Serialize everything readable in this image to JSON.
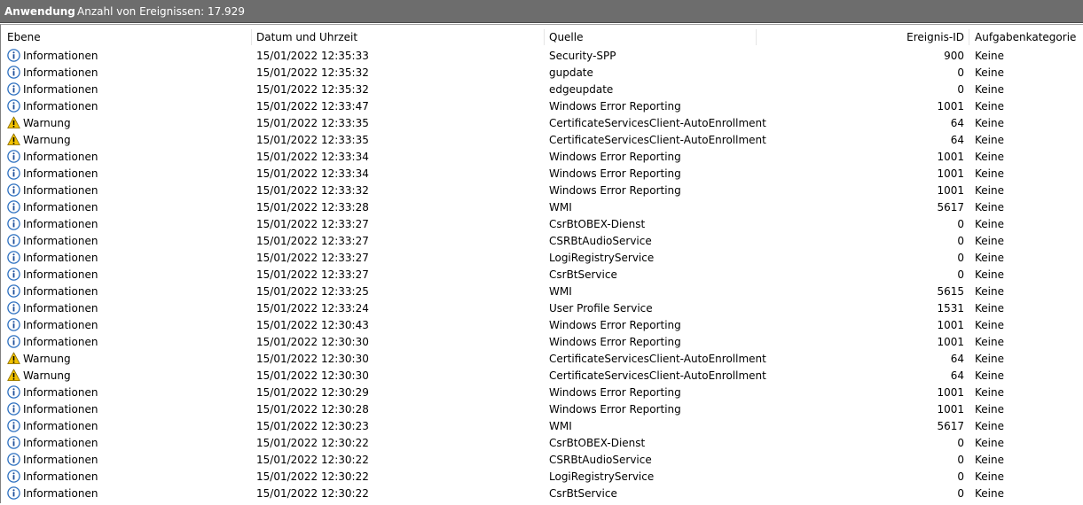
{
  "titlebar": {
    "title": "Anwendung",
    "count": "Anzahl von Ereignissen: 17.929"
  },
  "columns": {
    "level": "Ebene",
    "date": "Datum und Uhrzeit",
    "source": "Quelle",
    "id": "Ereignis-ID",
    "category": "Aufgabenkategorie"
  },
  "colors": {
    "titlebar": "#6d6d6d",
    "info_icon": "#2b6fc0",
    "warning_icon": "#f2c200"
  },
  "events": [
    {
      "level": "Informationen",
      "icon": "info-icon",
      "date": "15/01/2022 12:35:33",
      "source": "Security-SPP",
      "id": "900",
      "category": "Keine"
    },
    {
      "level": "Informationen",
      "icon": "info-icon",
      "date": "15/01/2022 12:35:32",
      "source": "gupdate",
      "id": "0",
      "category": "Keine"
    },
    {
      "level": "Informationen",
      "icon": "info-icon",
      "date": "15/01/2022 12:35:32",
      "source": "edgeupdate",
      "id": "0",
      "category": "Keine"
    },
    {
      "level": "Informationen",
      "icon": "info-icon",
      "date": "15/01/2022 12:33:47",
      "source": "Windows Error Reporting",
      "id": "1001",
      "category": "Keine"
    },
    {
      "level": "Warnung",
      "icon": "warning-icon",
      "date": "15/01/2022 12:33:35",
      "source": "CertificateServicesClient-AutoEnrollment",
      "id": "64",
      "category": "Keine"
    },
    {
      "level": "Warnung",
      "icon": "warning-icon",
      "date": "15/01/2022 12:33:35",
      "source": "CertificateServicesClient-AutoEnrollment",
      "id": "64",
      "category": "Keine"
    },
    {
      "level": "Informationen",
      "icon": "info-icon",
      "date": "15/01/2022 12:33:34",
      "source": "Windows Error Reporting",
      "id": "1001",
      "category": "Keine"
    },
    {
      "level": "Informationen",
      "icon": "info-icon",
      "date": "15/01/2022 12:33:34",
      "source": "Windows Error Reporting",
      "id": "1001",
      "category": "Keine"
    },
    {
      "level": "Informationen",
      "icon": "info-icon",
      "date": "15/01/2022 12:33:32",
      "source": "Windows Error Reporting",
      "id": "1001",
      "category": "Keine"
    },
    {
      "level": "Informationen",
      "icon": "info-icon",
      "date": "15/01/2022 12:33:28",
      "source": "WMI",
      "id": "5617",
      "category": "Keine"
    },
    {
      "level": "Informationen",
      "icon": "info-icon",
      "date": "15/01/2022 12:33:27",
      "source": "CsrBtOBEX-Dienst",
      "id": "0",
      "category": "Keine"
    },
    {
      "level": "Informationen",
      "icon": "info-icon",
      "date": "15/01/2022 12:33:27",
      "source": "CSRBtAudioService",
      "id": "0",
      "category": "Keine"
    },
    {
      "level": "Informationen",
      "icon": "info-icon",
      "date": "15/01/2022 12:33:27",
      "source": "LogiRegistryService",
      "id": "0",
      "category": "Keine"
    },
    {
      "level": "Informationen",
      "icon": "info-icon",
      "date": "15/01/2022 12:33:27",
      "source": "CsrBtService",
      "id": "0",
      "category": "Keine"
    },
    {
      "level": "Informationen",
      "icon": "info-icon",
      "date": "15/01/2022 12:33:25",
      "source": "WMI",
      "id": "5615",
      "category": "Keine"
    },
    {
      "level": "Informationen",
      "icon": "info-icon",
      "date": "15/01/2022 12:33:24",
      "source": "User Profile Service",
      "id": "1531",
      "category": "Keine"
    },
    {
      "level": "Informationen",
      "icon": "info-icon",
      "date": "15/01/2022 12:30:43",
      "source": "Windows Error Reporting",
      "id": "1001",
      "category": "Keine"
    },
    {
      "level": "Informationen",
      "icon": "info-icon",
      "date": "15/01/2022 12:30:30",
      "source": "Windows Error Reporting",
      "id": "1001",
      "category": "Keine"
    },
    {
      "level": "Warnung",
      "icon": "warning-icon",
      "date": "15/01/2022 12:30:30",
      "source": "CertificateServicesClient-AutoEnrollment",
      "id": "64",
      "category": "Keine"
    },
    {
      "level": "Warnung",
      "icon": "warning-icon",
      "date": "15/01/2022 12:30:30",
      "source": "CertificateServicesClient-AutoEnrollment",
      "id": "64",
      "category": "Keine"
    },
    {
      "level": "Informationen",
      "icon": "info-icon",
      "date": "15/01/2022 12:30:29",
      "source": "Windows Error Reporting",
      "id": "1001",
      "category": "Keine"
    },
    {
      "level": "Informationen",
      "icon": "info-icon",
      "date": "15/01/2022 12:30:28",
      "source": "Windows Error Reporting",
      "id": "1001",
      "category": "Keine"
    },
    {
      "level": "Informationen",
      "icon": "info-icon",
      "date": "15/01/2022 12:30:23",
      "source": "WMI",
      "id": "5617",
      "category": "Keine"
    },
    {
      "level": "Informationen",
      "icon": "info-icon",
      "date": "15/01/2022 12:30:22",
      "source": "CsrBtOBEX-Dienst",
      "id": "0",
      "category": "Keine"
    },
    {
      "level": "Informationen",
      "icon": "info-icon",
      "date": "15/01/2022 12:30:22",
      "source": "CSRBtAudioService",
      "id": "0",
      "category": "Keine"
    },
    {
      "level": "Informationen",
      "icon": "info-icon",
      "date": "15/01/2022 12:30:22",
      "source": "LogiRegistryService",
      "id": "0",
      "category": "Keine"
    },
    {
      "level": "Informationen",
      "icon": "info-icon",
      "date": "15/01/2022 12:30:22",
      "source": "CsrBtService",
      "id": "0",
      "category": "Keine"
    }
  ]
}
